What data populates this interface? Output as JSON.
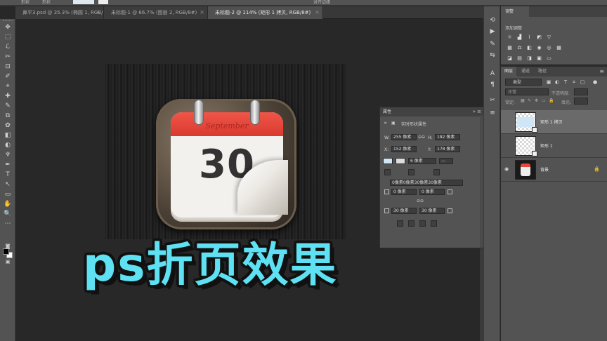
{
  "optbar": {
    "tool_label": "形状",
    "mode_label": "形状",
    "right_label": "对齐边缘"
  },
  "tabs": [
    {
      "label": "鼻平3.psd @ 35.3% (椭圆 1, RGB/8#)",
      "active": false
    },
    {
      "label": "未标题-1 @ 66.7% (图层 2, RGB/8#)",
      "active": false
    },
    {
      "label": "未标题-2 @ 114% (矩形 1 拷贝, RGB/8#)",
      "active": true
    }
  ],
  "tab_close": "×",
  "tools": [
    "✥",
    "⬚",
    "ℒ",
    "✂",
    "⊡",
    "✐",
    "⌖",
    "✚",
    "✎",
    "⧉",
    "✿",
    "◧",
    "◐",
    "♆",
    "✒",
    "T",
    "↖",
    "▭",
    "✋",
    "🔍",
    "⋯"
  ],
  "canvas": {
    "calendar_month": "September",
    "calendar_day": "30"
  },
  "properties": {
    "title": "属性",
    "subtitle": "实时形状属性",
    "w_label": "W:",
    "w_value": "255 像素",
    "h_label": "H:",
    "h_value": "182 像素",
    "x_label": "X:",
    "x_value": "152 像素",
    "y_label": "Y:",
    "y_value": "178 像素",
    "stroke_width": "6 像素",
    "corner_all": "0像素0像素30像素30像素",
    "corner_tl": "0 像素",
    "corner_tr": "0 像素",
    "corner_bl": "30 像素",
    "corner_br": "30 像素",
    "fill_color": "#cfe6f7"
  },
  "adjust_panel": {
    "tab": "调整",
    "sub": "添加调整"
  },
  "layers_panel": {
    "tabs": [
      "图层",
      "通道",
      "路径"
    ],
    "filter": "类型",
    "blend": "正常",
    "opacity_label": "不透明度:",
    "fill_label": "填充:",
    "lock_label": "锁定:",
    "layers": [
      {
        "name": "矩形 1 拷贝",
        "selected": true,
        "visible": false,
        "thumb": "shape"
      },
      {
        "name": "矩形 1",
        "selected": false,
        "visible": false,
        "thumb": "shape"
      },
      {
        "name": "背景",
        "selected": false,
        "visible": true,
        "thumb": "photo"
      }
    ]
  },
  "overlay_title": "ps折页效果",
  "colors": {
    "overlay": "#5ee1f3",
    "calendar_red": "#e24a3e"
  }
}
